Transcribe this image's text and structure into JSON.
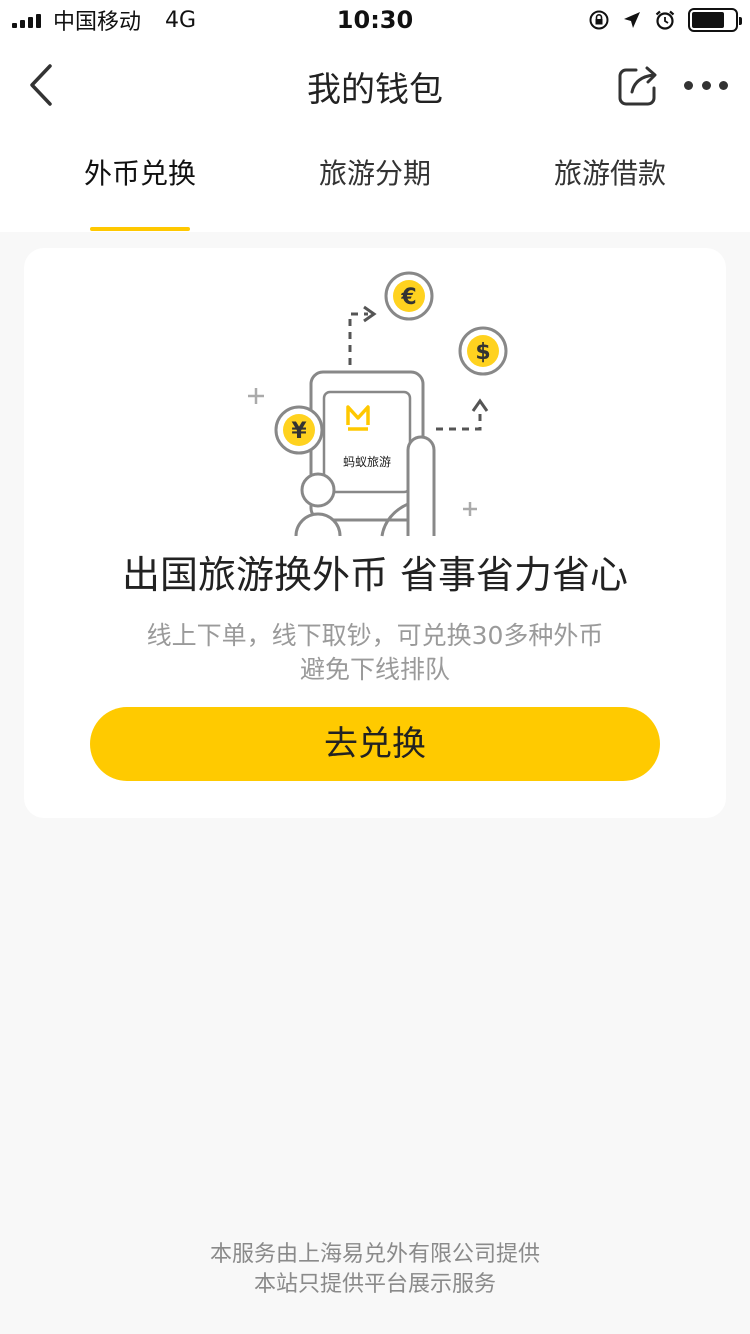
{
  "status_bar": {
    "carrier": "中国移动",
    "network": "4G",
    "time": "10:30",
    "icons": [
      "signal-icon",
      "orientation-lock-icon",
      "location-arrow-icon",
      "alarm-icon",
      "battery-icon"
    ],
    "battery_level": 0.75
  },
  "nav": {
    "title": "我的钱包",
    "back_icon": "chevron-left-icon",
    "share_icon": "share-icon",
    "more_icon": "more-icon"
  },
  "tabs": [
    {
      "label": "外币兑换",
      "active": true
    },
    {
      "label": "旅游分期",
      "active": false
    },
    {
      "label": "旅游借款",
      "active": false
    }
  ],
  "card": {
    "illustration": {
      "app_name": "蚂蚁旅游",
      "coins": [
        "€",
        "$",
        "¥"
      ]
    },
    "headline": "出国旅游换外币 省事省力省心",
    "subtitle_line1": "线上下单，线下取钞，可兑换30多种外币",
    "subtitle_line2": "避免下线排队",
    "cta_label": "去兑换"
  },
  "footer": {
    "line1": "本服务由上海易兑外有限公司提供",
    "line2": "本站只提供平台展示服务"
  },
  "colors": {
    "accent": "#ffca00",
    "background": "#f8f8f8",
    "card": "#ffffff",
    "muted_text": "#9a9a9a"
  }
}
